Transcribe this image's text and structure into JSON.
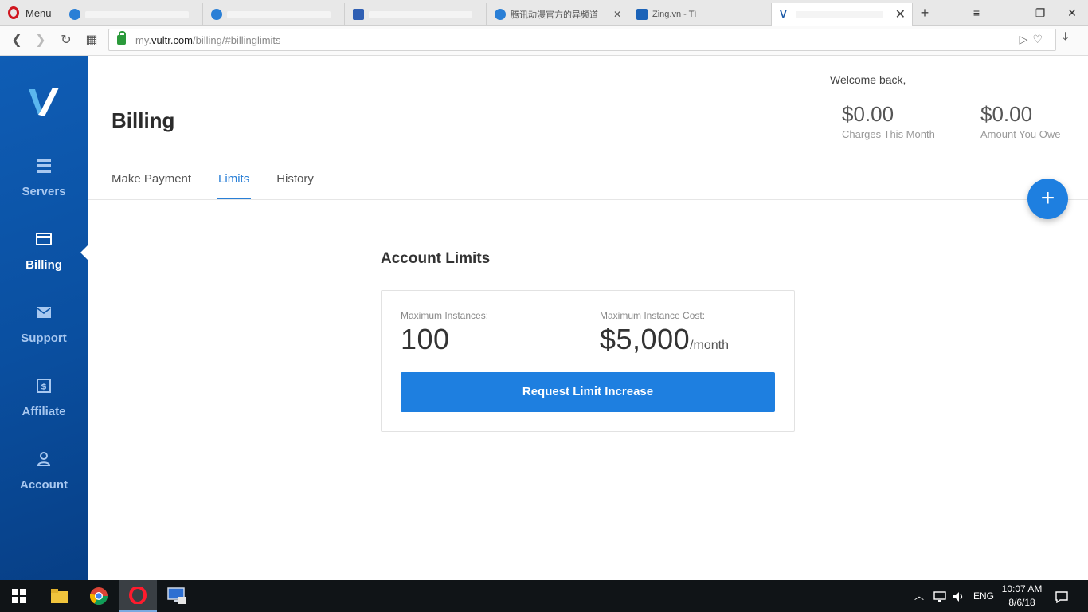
{
  "browser": {
    "menu_label": "Menu",
    "tabs": [
      {
        "title": "",
        "active": false
      },
      {
        "title": "",
        "active": false
      },
      {
        "title": "",
        "active": false
      },
      {
        "title": "腾讯动漫官方的异频道",
        "active": false
      },
      {
        "title": "Zing.vn - Tì",
        "active": false
      },
      {
        "title": "",
        "active": true
      }
    ],
    "url_prefix": "my.",
    "url_domain": "vultr.com",
    "url_path": "/billing/#billinglimits"
  },
  "sidebar": {
    "items": [
      {
        "label": "Servers",
        "icon": "servers-icon"
      },
      {
        "label": "Billing",
        "icon": "billing-card-icon",
        "active": true
      },
      {
        "label": "Support",
        "icon": "envelope-icon"
      },
      {
        "label": "Affiliate",
        "icon": "dollar-icon"
      },
      {
        "label": "Account",
        "icon": "user-icon"
      }
    ]
  },
  "header": {
    "title": "Billing",
    "welcome": "Welcome back,",
    "charges_amount": "$0.00",
    "charges_label": "Charges This Month",
    "owe_amount": "$0.00",
    "owe_label": "Amount You Owe"
  },
  "tabs": [
    {
      "label": "Make Payment"
    },
    {
      "label": "Limits",
      "active": true
    },
    {
      "label": "History"
    }
  ],
  "fab": {
    "label": "+"
  },
  "limits": {
    "section_title": "Account Limits",
    "max_instances_label": "Maximum Instances:",
    "max_instances_value": "100",
    "max_cost_label": "Maximum Instance Cost:",
    "max_cost_value": "$5,000",
    "max_cost_unit": "/month",
    "button_label": "Request Limit Increase"
  },
  "taskbar": {
    "language": "ENG",
    "time": "10:07 AM",
    "date": "8/6/18"
  },
  "colors": {
    "accent": "#1e7fe0",
    "sidebar": "#0a4fa0"
  }
}
